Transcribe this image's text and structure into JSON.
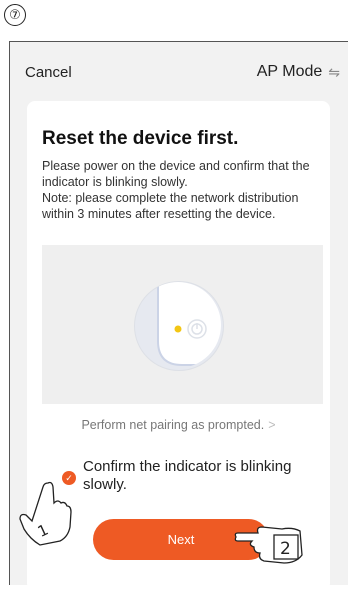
{
  "step_marker": "⑦",
  "navbar": {
    "cancel_label": "Cancel",
    "mode_label": "AP Mode",
    "mode_icon": "swap-icon"
  },
  "card": {
    "title": "Reset the device first.",
    "description_line1": "Please power on the device and confirm that the indicator is blinking slowly.",
    "description_line2": "Note: please complete the network distribution within 3 minutes after resetting the device.",
    "prompt_link": "Perform net pairing as prompted.",
    "confirm_label": "Confirm the indicator is blinking slowly.",
    "confirm_checked": true,
    "next_label": "Next"
  },
  "annotations": {
    "hand1_number": "1",
    "hand2_number": "2"
  },
  "colors": {
    "accent": "#ee5a24",
    "indicator_led": "#f3c614",
    "background": "#f2f2f2"
  }
}
